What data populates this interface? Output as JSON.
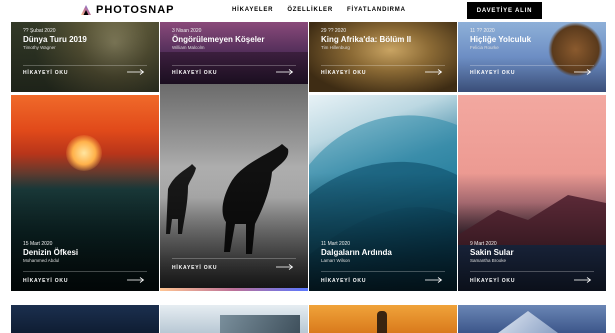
{
  "nav": {
    "logo": "PHOTOSNAP",
    "links": [
      "HİKAYELER",
      "ÖZELLİKLER",
      "FİYATLANDIRMA"
    ],
    "cta": "DAVETİYE ALIN"
  },
  "stories": [
    {
      "date": "?? Şubat 2020",
      "title": "Dünya Turu 2019",
      "author": "Timothy Wagner",
      "read": "HİKAYEYİ OKU"
    },
    {
      "date": "3 Nisan 2020",
      "title": "Öngörülemeyen Köşeler",
      "author": "William Malcolm",
      "read": "HİKAYEYİ OKU"
    },
    {
      "date": "29 ?? 2020",
      "title": "King Afrika'da: Bölüm II",
      "author": "Tim Hillenburg",
      "read": "HİKAYEYİ OKU"
    },
    {
      "date": "11 ?? 2020",
      "title": "Hiçliğe Yolculuk",
      "author": "Felicia Rourke",
      "read": "HİKAYEYİ OKU"
    },
    {
      "date": "15 Mart 2020",
      "title": "Denizin Öfkesi",
      "author": "Mohammed Abdul",
      "read": "HİKAYEYİ OKU"
    },
    {
      "date": "",
      "title": "",
      "author": "",
      "read": "HİKAYEYİ OKU"
    },
    {
      "date": "11 Mart 2020",
      "title": "Dalgaların Ardında",
      "author": "Lamarr Wilson",
      "read": "HİKAYEYİ OKU"
    },
    {
      "date": "9 Mart 2020",
      "title": "Sakin Sular",
      "author": "Samantha Brooke",
      "read": "HİKAYEYİ OKU"
    }
  ],
  "colors": {
    "accent_gradient": [
      "#ffc593",
      "#bc7198",
      "#5a77ff"
    ],
    "nav_button": "#000000"
  }
}
